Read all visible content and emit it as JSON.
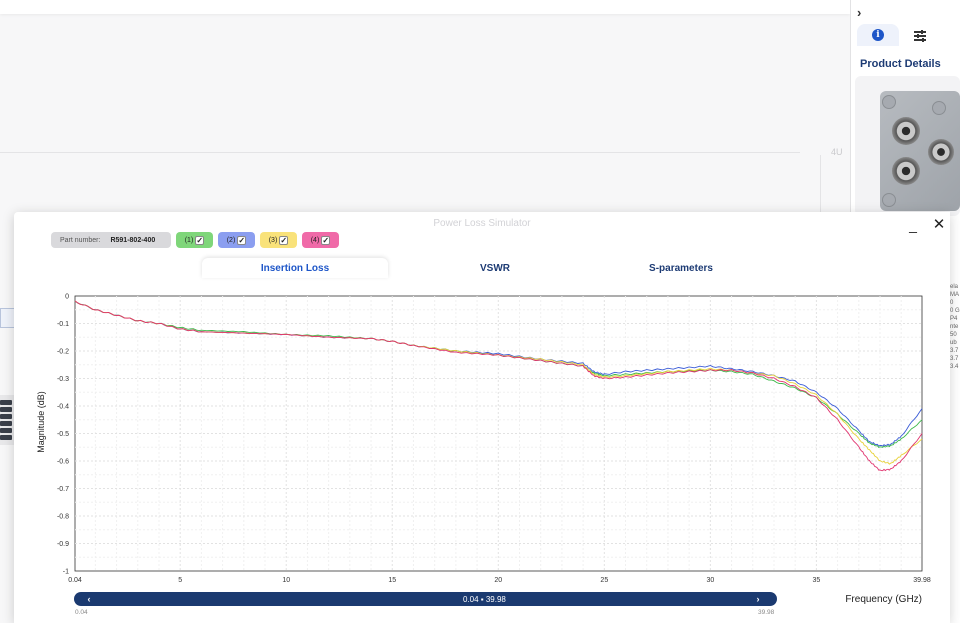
{
  "background": {
    "rack_label": "4U"
  },
  "side_panel": {
    "collapse_chevron": "›",
    "tabs": [
      {
        "name": "info",
        "icon": "info-icon"
      },
      {
        "name": "settings",
        "icon": "sliders-icon"
      }
    ],
    "title": "Product Details",
    "partial_text": "ela\nMA\n0\n0 G\nP4\nnte\n50\nub\n3.7\n3.7\n3.4"
  },
  "modal": {
    "title": "Power Loss Simulator",
    "minimize": "_",
    "close": "✕",
    "part_number_label": "Part number:",
    "part_number_value": "R591-802-400",
    "filters": [
      {
        "label": "(1)",
        "color": "#7fd67a",
        "checked": true
      },
      {
        "label": "(2)",
        "color": "#8b9ef0",
        "checked": true
      },
      {
        "label": "(3)",
        "color": "#f9e27a",
        "checked": true
      },
      {
        "label": "(4)",
        "color": "#f06aa8",
        "checked": true
      }
    ],
    "tabs": [
      {
        "label": "Insertion Loss",
        "active": true
      },
      {
        "label": "VSWR",
        "active": false
      },
      {
        "label": "S-parameters",
        "active": false
      }
    ],
    "range": {
      "left_arrow": "‹",
      "right_arrow": "›",
      "label": "0.04 ▪ 39.98",
      "min": "0.04",
      "max": "39.98"
    }
  },
  "chart_data": {
    "type": "line",
    "title": "",
    "xlabel": "Frequency (GHz)",
    "ylabel": "Magnitude (dB)",
    "xlim": [
      0.04,
      39.98
    ],
    "ylim": [
      -1,
      0
    ],
    "x_ticks": [
      "0.04",
      "5",
      "10",
      "15",
      "20",
      "25",
      "30",
      "35",
      "39.98"
    ],
    "x_tick_values": [
      0.04,
      5,
      10,
      15,
      20,
      25,
      30,
      35,
      39.98
    ],
    "y_ticks": [
      "0",
      "-0.1",
      "-0.2",
      "-0.3",
      "-0.4",
      "-0.5",
      "-0.6",
      "-0.7",
      "-0.8",
      "-0.9",
      "-1"
    ],
    "y_tick_values": [
      0,
      -0.1,
      -0.2,
      -0.3,
      -0.4,
      -0.5,
      -0.6,
      -0.7,
      -0.8,
      -0.9,
      -1
    ],
    "grid": true,
    "x": [
      0.04,
      1,
      2,
      3,
      4,
      5,
      6,
      8,
      10,
      12,
      14,
      15,
      16,
      18,
      20,
      22,
      24,
      24.5,
      25,
      26,
      28,
      30,
      31,
      32,
      33,
      34,
      35,
      36,
      37,
      37.5,
      38,
      38.5,
      39,
      39.98
    ],
    "series": [
      {
        "color": "#3a5bd6",
        "values": [
          -0.02,
          -0.05,
          -0.07,
          -0.09,
          -0.1,
          -0.12,
          -0.13,
          -0.135,
          -0.14,
          -0.15,
          -0.155,
          -0.165,
          -0.18,
          -0.2,
          -0.21,
          -0.23,
          -0.245,
          -0.275,
          -0.285,
          -0.275,
          -0.265,
          -0.255,
          -0.265,
          -0.275,
          -0.29,
          -0.31,
          -0.35,
          -0.41,
          -0.49,
          -0.53,
          -0.545,
          -0.54,
          -0.51,
          -0.41
        ]
      },
      {
        "color": "#3db84a",
        "values": [
          -0.02,
          -0.05,
          -0.07,
          -0.09,
          -0.1,
          -0.115,
          -0.125,
          -0.13,
          -0.14,
          -0.145,
          -0.155,
          -0.165,
          -0.18,
          -0.2,
          -0.215,
          -0.235,
          -0.255,
          -0.28,
          -0.29,
          -0.285,
          -0.275,
          -0.27,
          -0.275,
          -0.285,
          -0.31,
          -0.335,
          -0.37,
          -0.43,
          -0.5,
          -0.535,
          -0.55,
          -0.545,
          -0.52,
          -0.45
        ]
      },
      {
        "color": "#e8d23a",
        "values": [
          -0.02,
          -0.05,
          -0.07,
          -0.09,
          -0.1,
          -0.12,
          -0.13,
          -0.135,
          -0.14,
          -0.15,
          -0.155,
          -0.165,
          -0.18,
          -0.2,
          -0.215,
          -0.23,
          -0.25,
          -0.285,
          -0.295,
          -0.29,
          -0.275,
          -0.265,
          -0.27,
          -0.28,
          -0.29,
          -0.32,
          -0.36,
          -0.43,
          -0.52,
          -0.56,
          -0.6,
          -0.61,
          -0.58,
          -0.52
        ]
      },
      {
        "color": "#e0336e",
        "values": [
          -0.02,
          -0.05,
          -0.07,
          -0.09,
          -0.1,
          -0.12,
          -0.13,
          -0.135,
          -0.14,
          -0.15,
          -0.155,
          -0.165,
          -0.18,
          -0.205,
          -0.215,
          -0.235,
          -0.255,
          -0.29,
          -0.3,
          -0.295,
          -0.28,
          -0.27,
          -0.27,
          -0.28,
          -0.3,
          -0.33,
          -0.37,
          -0.45,
          -0.55,
          -0.6,
          -0.635,
          -0.63,
          -0.6,
          -0.5
        ]
      }
    ]
  }
}
